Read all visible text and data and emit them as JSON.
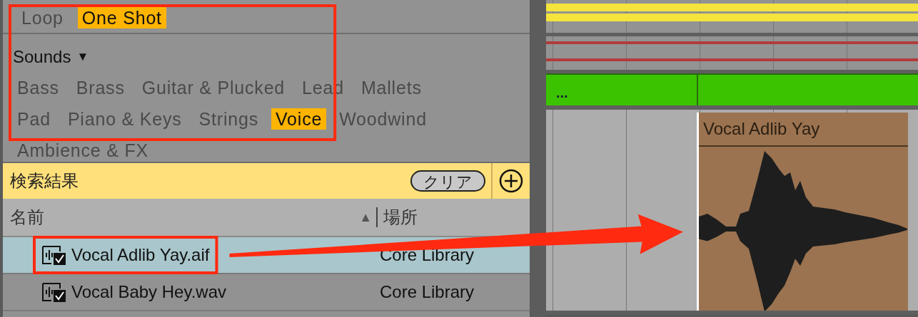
{
  "browser": {
    "sample_types": [
      {
        "label": "Loop",
        "selected": false
      },
      {
        "label": "One Shot",
        "selected": true
      }
    ],
    "sounds_filter": {
      "label": "Sounds",
      "toggle": "▼",
      "categories": [
        {
          "label": "Bass",
          "selected": false
        },
        {
          "label": "Brass",
          "selected": false
        },
        {
          "label": "Guitar & Plucked",
          "selected": false
        },
        {
          "label": "Lead",
          "selected": false
        },
        {
          "label": "Mallets",
          "selected": false
        },
        {
          "label": "Pad",
          "selected": false
        },
        {
          "label": "Piano & Keys",
          "selected": false
        },
        {
          "label": "Strings",
          "selected": false
        },
        {
          "label": "Voice",
          "selected": true
        },
        {
          "label": "Woodwind",
          "selected": false
        },
        {
          "label": "Ambience & FX",
          "selected": false
        }
      ]
    },
    "search_results": {
      "title": "検索結果",
      "clear_button": "クリア",
      "columns": [
        {
          "label": "名前",
          "sort": "▲"
        },
        {
          "label": "場所"
        }
      ],
      "rows": [
        {
          "name": "Vocal Adlib Yay.aif",
          "location": "Core Library",
          "selected": true
        },
        {
          "name": "Vocal Baby Hey.wav",
          "location": "Core Library",
          "selected": false
        }
      ]
    }
  },
  "arrangement": {
    "tracks": [
      {
        "kind": "bands",
        "color": "#f4e43c"
      },
      {
        "kind": "lines",
        "color": "#b23c3c"
      },
      {
        "kind": "group",
        "color": "#3cc300",
        "label": "..."
      },
      {
        "kind": "audio",
        "clip": {
          "name": "Vocal Adlib Yay",
          "color": "#9b7350"
        }
      }
    ]
  },
  "annotations": [
    {
      "kind": "box"
    },
    {
      "kind": "box"
    },
    {
      "kind": "arrow"
    }
  ]
}
